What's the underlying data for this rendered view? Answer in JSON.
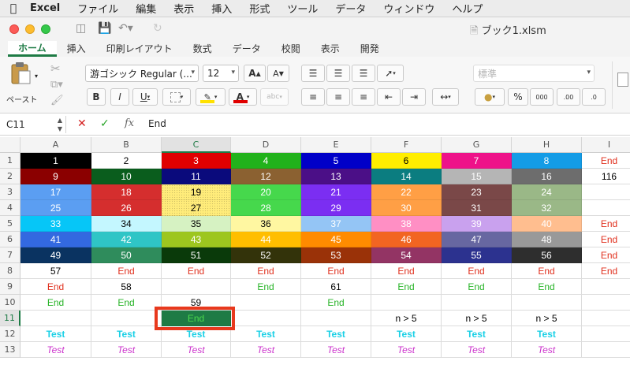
{
  "menubar": {
    "app": "Excel",
    "items": [
      "ファイル",
      "編集",
      "表示",
      "挿入",
      "形式",
      "ツール",
      "データ",
      "ウィンドウ",
      "ヘルプ"
    ]
  },
  "window": {
    "title": "ブック1.xlsm"
  },
  "ribbon": {
    "tabs": [
      "ホーム",
      "挿入",
      "印刷レイアウト",
      "数式",
      "データ",
      "校閲",
      "表示",
      "開発"
    ],
    "active_tab": 0,
    "paste_label": "ペースト",
    "font_name": "游ゴシック Regular (...",
    "font_size": "12",
    "number_format": "標準",
    "font_color": "#e00000",
    "fill_color": "#ffe100"
  },
  "formula_bar": {
    "cell_ref": "C11",
    "value": "End"
  },
  "columns": [
    "A",
    "B",
    "C",
    "D",
    "E",
    "F",
    "G",
    "H",
    "I"
  ],
  "selected_column": "C",
  "rows": [
    "1",
    "2",
    "3",
    "4",
    "5",
    "6",
    "7",
    "8",
    "9",
    "10",
    "11",
    "12",
    "13"
  ],
  "selected_row": "11",
  "cells": [
    [
      {
        "v": "1",
        "bg": "#000000",
        "fg": "#ffffff"
      },
      {
        "v": "2",
        "bg": "#ffffff",
        "fg": "#000000"
      },
      {
        "v": "3",
        "bg": "#e00000",
        "fg": "#ffffff"
      },
      {
        "v": "4",
        "bg": "#21b21b",
        "fg": "#ffffff"
      },
      {
        "v": "5",
        "bg": "#0000c8",
        "fg": "#ffffff"
      },
      {
        "v": "6",
        "bg": "#ffee00",
        "fg": "#000000"
      },
      {
        "v": "7",
        "bg": "#ee1289",
        "fg": "#ffffff"
      },
      {
        "v": "8",
        "bg": "#149ce6",
        "fg": "#ffffff"
      },
      {
        "v": "End",
        "fg": "#e0301e"
      }
    ],
    [
      {
        "v": "9",
        "bg": "#8b0000",
        "fg": "#ffffff"
      },
      {
        "v": "10",
        "bg": "#0a5d1d",
        "fg": "#ffffff"
      },
      {
        "v": "11",
        "bg": "#0a0a7c",
        "fg": "#ffffff"
      },
      {
        "v": "12",
        "bg": "#8b6131",
        "fg": "#ffffff"
      },
      {
        "v": "13",
        "bg": "#4b0f87",
        "fg": "#ffffff"
      },
      {
        "v": "14",
        "bg": "#0b7d80",
        "fg": "#ffffff"
      },
      {
        "v": "15",
        "bg": "#b5b5b5",
        "fg": "#ffffff"
      },
      {
        "v": "16",
        "bg": "#6d6d6d",
        "fg": "#ffffff"
      },
      {
        "v": "116",
        "fg": "#000000"
      }
    ],
    [
      {
        "v": "17",
        "bg": "#5b9ef2",
        "fg": "#ffffff"
      },
      {
        "v": "18",
        "bg": "#d52e2e",
        "fg": "#ffffff"
      },
      {
        "v": "19",
        "bg": "#ffec7a",
        "fg": "#000000",
        "dotted": true
      },
      {
        "v": "20",
        "bg": "#46d84c",
        "fg": "#ffffff"
      },
      {
        "v": "21",
        "bg": "#7b2ef2",
        "fg": "#ffffff"
      },
      {
        "v": "22",
        "bg": "#ff9f45",
        "fg": "#ffffff"
      },
      {
        "v": "23",
        "bg": "#7a4848",
        "fg": "#ffffff"
      },
      {
        "v": "24",
        "bg": "#9ab887",
        "fg": "#ffffff"
      },
      {
        "v": ""
      }
    ],
    [
      {
        "v": "25",
        "bg": "#5b9ef2",
        "fg": "#ffffff"
      },
      {
        "v": "26",
        "bg": "#d52e2e",
        "fg": "#ffffff"
      },
      {
        "v": "27",
        "bg": "#ffec7a",
        "fg": "#000000",
        "dotted": true
      },
      {
        "v": "28",
        "bg": "#46d84c",
        "fg": "#ffffff"
      },
      {
        "v": "29",
        "bg": "#7b2ef2",
        "fg": "#ffffff"
      },
      {
        "v": "30",
        "bg": "#ff9f45",
        "fg": "#ffffff"
      },
      {
        "v": "31",
        "bg": "#7a4848",
        "fg": "#ffffff"
      },
      {
        "v": "32",
        "bg": "#9ab887",
        "fg": "#ffffff"
      },
      {
        "v": ""
      }
    ],
    [
      {
        "v": "33",
        "bg": "#06c6f7",
        "fg": "#ffffff"
      },
      {
        "v": "34",
        "bg": "#c4f7ff",
        "fg": "#000000"
      },
      {
        "v": "35",
        "bg": "#d6f2c2",
        "fg": "#000000"
      },
      {
        "v": "36",
        "bg": "#fff7a1",
        "fg": "#000000"
      },
      {
        "v": "37",
        "bg": "#94c5f5",
        "fg": "#ffffff"
      },
      {
        "v": "38",
        "bg": "#ff8fc4",
        "fg": "#ffffff"
      },
      {
        "v": "39",
        "bg": "#c9a1ee",
        "fg": "#ffffff"
      },
      {
        "v": "40",
        "bg": "#ffbe8f",
        "fg": "#ffffff"
      },
      {
        "v": "End",
        "fg": "#e0301e"
      }
    ],
    [
      {
        "v": "41",
        "bg": "#3369e0",
        "fg": "#ffffff"
      },
      {
        "v": "42",
        "bg": "#2fc5c6",
        "fg": "#ffffff"
      },
      {
        "v": "43",
        "bg": "#9dc61f",
        "fg": "#ffffff"
      },
      {
        "v": "44",
        "bg": "#ffbe00",
        "fg": "#ffffff"
      },
      {
        "v": "45",
        "bg": "#ff8b00",
        "fg": "#ffffff"
      },
      {
        "v": "46",
        "bg": "#f26522",
        "fg": "#ffffff"
      },
      {
        "v": "47",
        "bg": "#6767a1",
        "fg": "#ffffff"
      },
      {
        "v": "48",
        "bg": "#999999",
        "fg": "#ffffff"
      },
      {
        "v": "End",
        "fg": "#e0301e"
      }
    ],
    [
      {
        "v": "49",
        "bg": "#0a3361",
        "fg": "#ffffff"
      },
      {
        "v": "50",
        "bg": "#2f8c5c",
        "fg": "#ffffff"
      },
      {
        "v": "51",
        "bg": "#0a3a0a",
        "fg": "#ffffff"
      },
      {
        "v": "52",
        "bg": "#33330a",
        "fg": "#ffffff"
      },
      {
        "v": "53",
        "bg": "#9a3208",
        "fg": "#ffffff"
      },
      {
        "v": "54",
        "bg": "#933464",
        "fg": "#ffffff"
      },
      {
        "v": "55",
        "bg": "#2c328f",
        "fg": "#ffffff"
      },
      {
        "v": "56",
        "bg": "#2e2e2e",
        "fg": "#ffffff"
      },
      {
        "v": "End",
        "fg": "#e0301e"
      }
    ],
    [
      {
        "v": "57",
        "fg": "#000000"
      },
      {
        "v": "End",
        "fg": "#e0301e"
      },
      {
        "v": "End",
        "fg": "#e0301e"
      },
      {
        "v": "End",
        "fg": "#e0301e"
      },
      {
        "v": "End",
        "fg": "#e0301e"
      },
      {
        "v": "End",
        "fg": "#e0301e"
      },
      {
        "v": "End",
        "fg": "#e0301e"
      },
      {
        "v": "End",
        "fg": "#e0301e"
      },
      {
        "v": "End",
        "fg": "#e0301e"
      }
    ],
    [
      {
        "v": "End",
        "fg": "#e0301e"
      },
      {
        "v": "58",
        "fg": "#000000"
      },
      {
        "v": ""
      },
      {
        "v": "End",
        "fg": "#28b428"
      },
      {
        "v": "61",
        "fg": "#000000"
      },
      {
        "v": "End",
        "fg": "#28b428"
      },
      {
        "v": "End",
        "fg": "#28b428"
      },
      {
        "v": "End",
        "fg": "#28b428"
      },
      {
        "v": ""
      }
    ],
    [
      {
        "v": "End",
        "fg": "#28b428"
      },
      {
        "v": "End",
        "fg": "#28b428"
      },
      {
        "v": "59",
        "fg": "#000000"
      },
      {
        "v": ""
      },
      {
        "v": "End",
        "fg": "#28b428"
      },
      {
        "v": ""
      },
      {
        "v": ""
      },
      {
        "v": ""
      },
      {
        "v": ""
      }
    ],
    [
      {
        "v": ""
      },
      {
        "v": ""
      },
      {
        "v": "End",
        "bg": "#1e7b45",
        "fg": "#4cd94c"
      },
      {
        "v": ""
      },
      {
        "v": ""
      },
      {
        "v": "n > 5",
        "fg": "#000000"
      },
      {
        "v": "n > 5",
        "fg": "#000000"
      },
      {
        "v": "n > 5",
        "fg": "#000000"
      },
      {
        "v": ""
      }
    ],
    [
      {
        "v": "Test",
        "fg": "#1ad0e6",
        "bold": true
      },
      {
        "v": "Test",
        "fg": "#1ad0e6",
        "bold": true
      },
      {
        "v": "Test",
        "fg": "#1ad0e6",
        "bold": true
      },
      {
        "v": "Test",
        "fg": "#1ad0e6",
        "bold": true
      },
      {
        "v": "Test",
        "fg": "#1ad0e6",
        "bold": true
      },
      {
        "v": "Test",
        "fg": "#1ad0e6",
        "bold": true
      },
      {
        "v": "Test",
        "fg": "#1ad0e6",
        "bold": true
      },
      {
        "v": "Test",
        "fg": "#1ad0e6",
        "bold": true
      },
      {
        "v": ""
      }
    ],
    [
      {
        "v": "Test",
        "fg": "#cc33cc",
        "italic": true
      },
      {
        "v": "Test",
        "fg": "#cc33cc",
        "italic": true
      },
      {
        "v": "Test",
        "fg": "#cc33cc",
        "italic": true
      },
      {
        "v": "Test",
        "fg": "#cc33cc",
        "italic": true
      },
      {
        "v": "Test",
        "fg": "#cc33cc",
        "italic": true
      },
      {
        "v": "Test",
        "fg": "#cc33cc",
        "italic": true
      },
      {
        "v": "Test",
        "fg": "#cc33cc",
        "italic": true
      },
      {
        "v": "Test",
        "fg": "#cc33cc",
        "italic": true
      },
      {
        "v": ""
      }
    ]
  ]
}
